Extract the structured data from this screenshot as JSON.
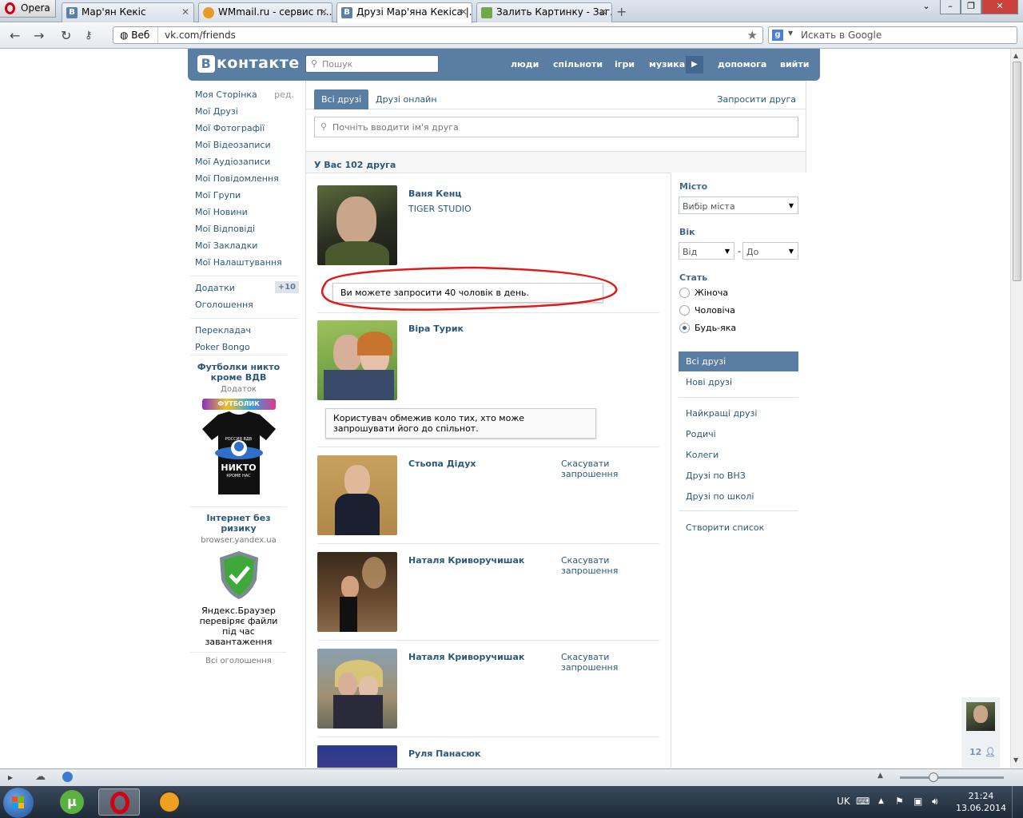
{
  "browser": {
    "opera_label": "Opera",
    "tabs": [
      {
        "title": "Мар'ян Кекіс",
        "active": false
      },
      {
        "title": "WMmail.ru - сервис п...",
        "active": false
      },
      {
        "title": "Друзі Мар'яна Кекіса |...",
        "active": true
      },
      {
        "title": "Залить Картинку - Заг...",
        "active": false
      }
    ],
    "veb_label": "Веб",
    "url": "vk.com/friends",
    "search_placeholder": "Искать в Google"
  },
  "vk": {
    "logo": "контакте",
    "search_placeholder": "Пошук",
    "nav": [
      "люди",
      "спільноти",
      "ігри",
      "музика",
      "допомога",
      "вийти"
    ]
  },
  "left_menu": {
    "items": [
      "Моя Сторінка",
      "Мої Друзі",
      "Мої Фотографії",
      "Мої Відеозаписи",
      "Мої Аудіозаписи",
      "Мої Повідомлення",
      "Мої Групи",
      "Мої Новини",
      "Мої Відповіді",
      "Мої Закладки",
      "Мої Налаштування"
    ],
    "edit_label": "ред.",
    "extra": [
      "Додатки",
      "Оголошення"
    ],
    "apps_badge": "+10",
    "apps": [
      "Перекладач",
      "Poker Bongo"
    ]
  },
  "ads": [
    {
      "title": "Футболки никто кроме ВДВ",
      "subtitle": "Додаток",
      "logo_text": "ФУТБОЛИК",
      "image_text_top": "РОССИЯ ВДВ",
      "image_text_main": "НИКТО",
      "image_text_sub": "КРОМЕ НАС"
    },
    {
      "title": "Інтернет без ризику",
      "subtitle": "browser.yandex.ua",
      "body": "Яндекс.Браузер перевіряє файли під час завантаження"
    }
  ],
  "all_ads_label": "Всі оголошення",
  "friends_page": {
    "tab_all": "Всі друзі",
    "tab_online": "Друзі онлайн",
    "invite_label": "Запросити друга",
    "search_placeholder": "Почніть вводити ім'я друга",
    "count_label": "У Вас 102 друга"
  },
  "friends": [
    {
      "name": "Ваня Кенц",
      "sub": "TIGER STUDIO",
      "action": ""
    },
    {
      "name": "Віра Турик",
      "sub": "",
      "action": ""
    },
    {
      "name": "Стьопа Дідух",
      "sub": "",
      "action": "Скасувати запрошення"
    },
    {
      "name": "Наталя Криворучишак",
      "sub": "",
      "action": "Скасувати запрошення"
    },
    {
      "name": "Наталя Криворучишак",
      "sub": "",
      "action": "Скасувати запрошення"
    },
    {
      "name": "Руля Панасюк",
      "sub": "",
      "action": ""
    }
  ],
  "tooltips": {
    "invite_limit": "Ви можете запросити 40 чоловік в день.",
    "restricted": "Користувач обмежив коло тих, хто може запрошувати його до спільнот."
  },
  "filters": {
    "city_label": "Місто",
    "city_select": "Вибір міста",
    "age_label": "Вік",
    "age_from": "Від",
    "age_to": "До",
    "age_dash": "-",
    "gender_label": "Стать",
    "gender_options": [
      "Жіноча",
      "Чоловіча",
      "Будь-яка"
    ],
    "gender_selected": "Будь-яка",
    "lists": [
      "Всі друзі",
      "Нові друзі"
    ],
    "categories": [
      "Найкращі друзі",
      "Родичі",
      "Колеги",
      "Друзі по ВНЗ",
      "Друзі по школі"
    ],
    "create_list": "Створити список"
  },
  "mini_profile": {
    "count": "12"
  },
  "taskbar": {
    "lang": "UK",
    "time": "21:24",
    "date": "13.06.2014"
  }
}
